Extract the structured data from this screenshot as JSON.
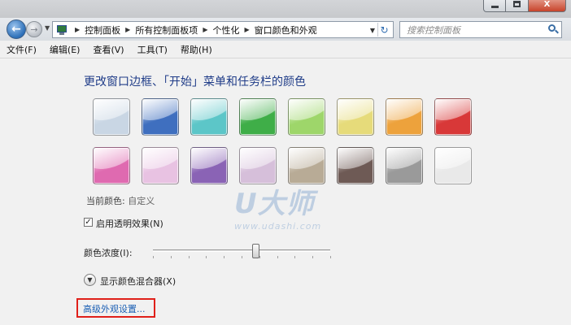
{
  "window": {
    "caption_buttons": {
      "minimize_icon": "minimize-icon",
      "maximize_icon": "maximize-icon",
      "close_label": "X"
    }
  },
  "nav": {
    "back_icon": "back-arrow-icon",
    "forward_icon": "forward-arrow-icon",
    "breadcrumbs": [
      "控制面板",
      "所有控制面板项",
      "个性化",
      "窗口颜色和外观"
    ],
    "search_placeholder": "搜索控制面板"
  },
  "menu": [
    "文件(F)",
    "编辑(E)",
    "查看(V)",
    "工具(T)",
    "帮助(H)"
  ],
  "heading": "更改窗口边框、「开始」菜单和任务栏的颜色",
  "swatches": [
    [
      "#c9d6e4",
      "#3f6fbf",
      "#5cc6c8",
      "#3fae48",
      "#9ed66a",
      "#e6db7a",
      "#eda23c",
      "#d83838"
    ],
    [
      "#df6ab0",
      "#e8c2e2",
      "#8a63b5",
      "#d6bfda",
      "#b8ab96",
      "#6e5a55",
      "#9a9a9a",
      "#e9e9e9"
    ]
  ],
  "current_color": {
    "label": "当前颜色:",
    "value": "自定义"
  },
  "transparency": {
    "label": "启用透明效果(N)",
    "checked": true
  },
  "intensity": {
    "label": "颜色浓度(I):",
    "value_fraction": 0.58
  },
  "mixer": {
    "label": "显示颜色混合器(X)"
  },
  "advanced_link": "高级外观设置...",
  "watermark": {
    "main": "U大师",
    "sub": "www.udashi.com"
  },
  "colors": {
    "heading": "#1f3c88",
    "link": "#1a5fb4",
    "highlight_box": "#e0201a"
  }
}
